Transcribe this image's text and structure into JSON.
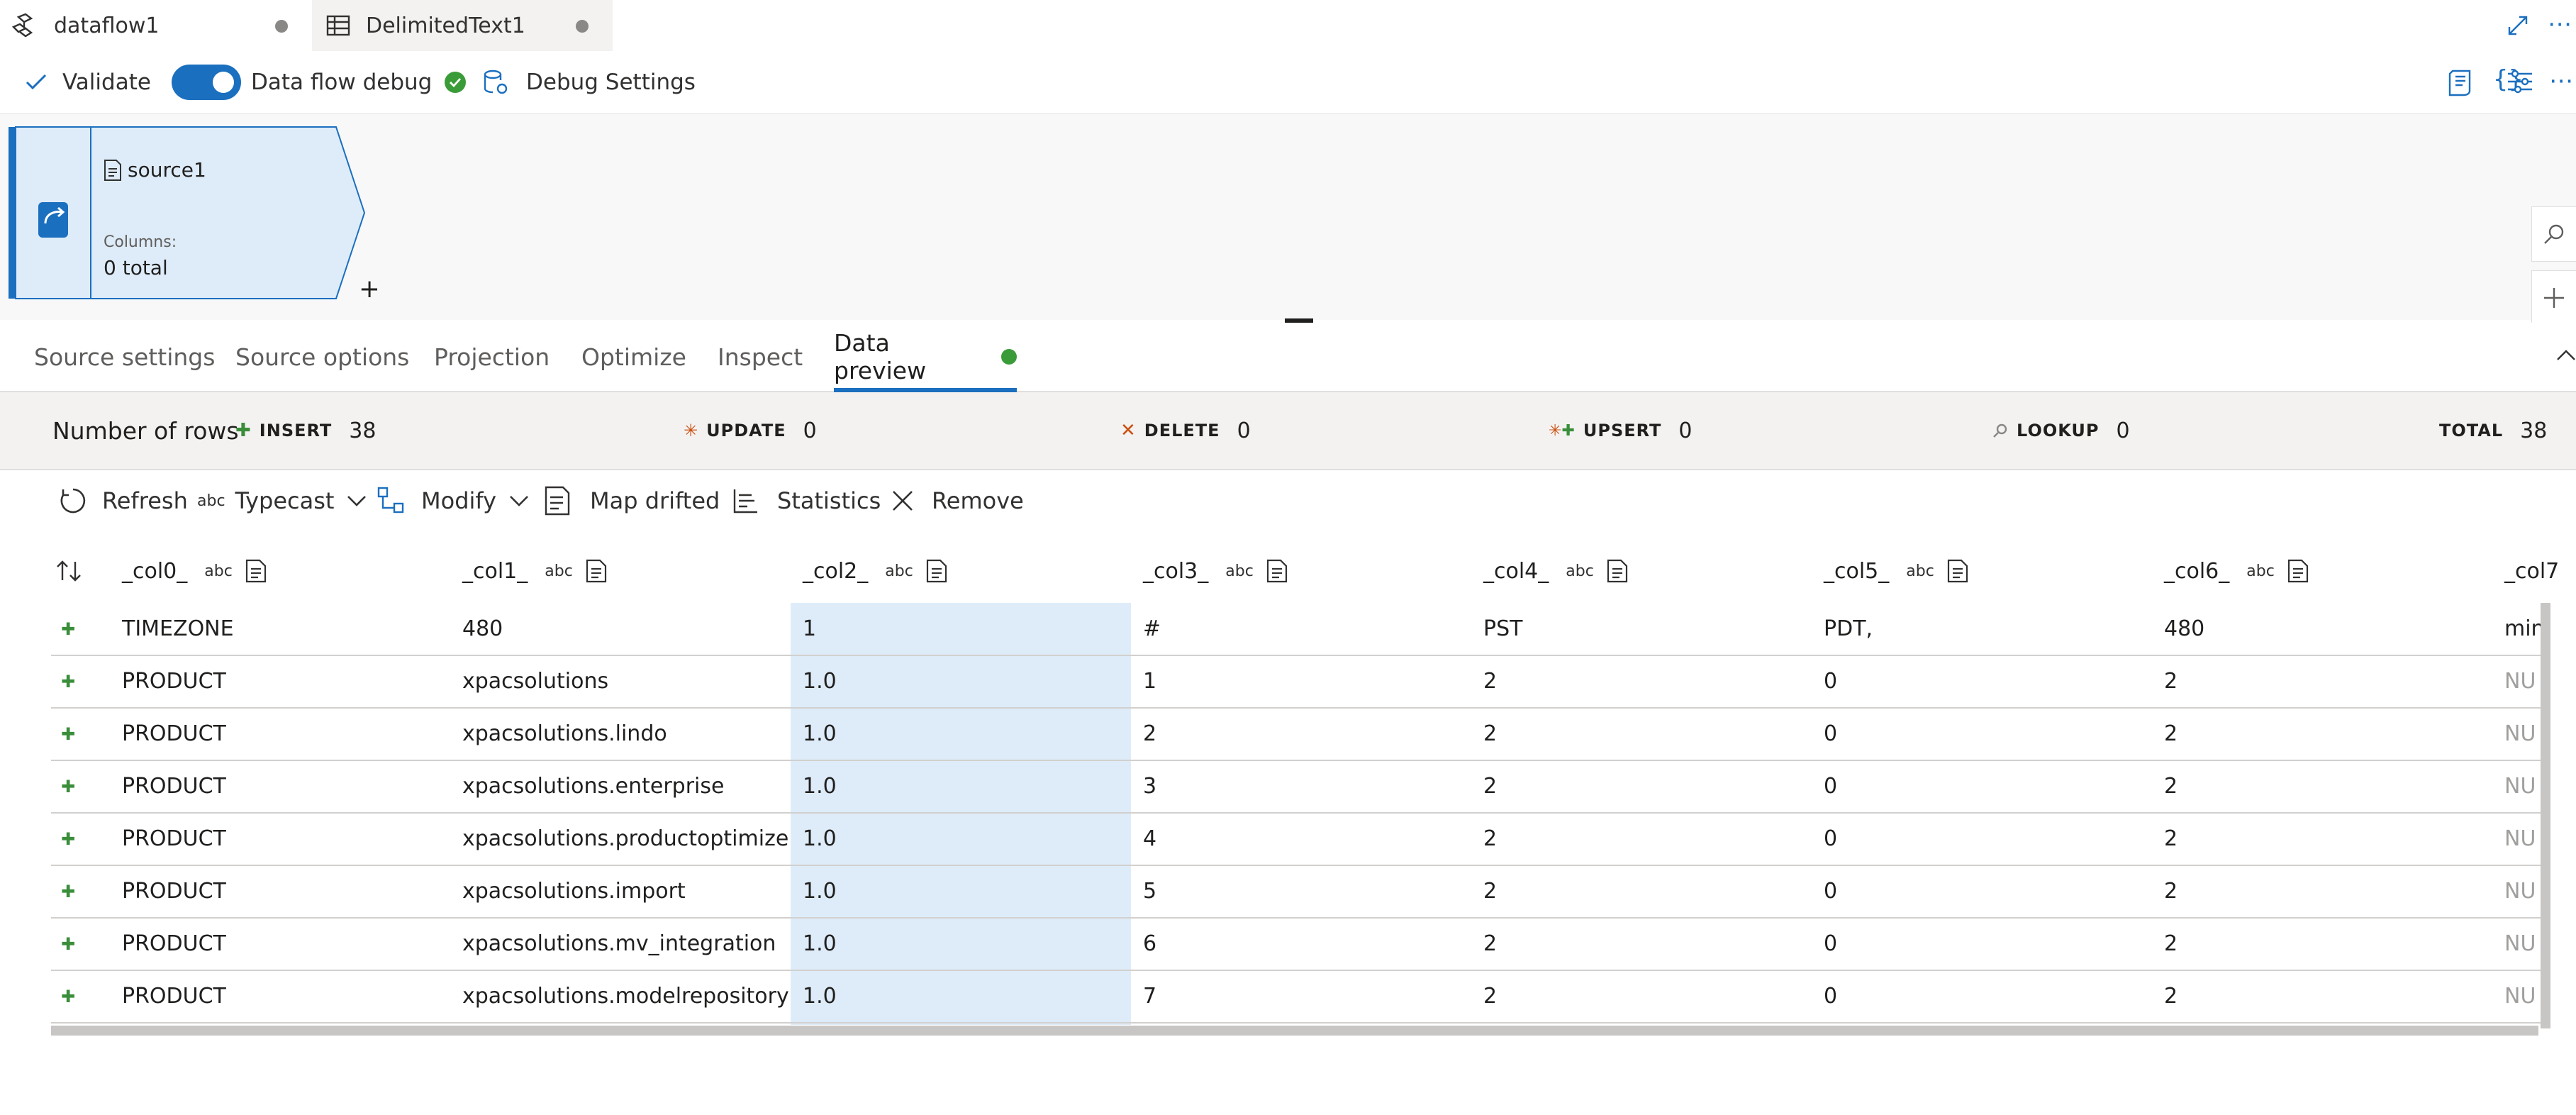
{
  "tabs": [
    {
      "label": "dataflow1",
      "icon": "dataflow-icon"
    },
    {
      "label": "DelimitedText1",
      "icon": "table-icon"
    }
  ],
  "commands": {
    "validate": "Validate",
    "debug": "Data flow debug",
    "debug_settings": "Debug Settings"
  },
  "node": {
    "name": "source1",
    "columns_label": "Columns:",
    "columns_value": "0 total"
  },
  "property_tabs": [
    "Source settings",
    "Source options",
    "Projection",
    "Optimize",
    "Inspect",
    "Data preview"
  ],
  "counts": {
    "title": "Number of rows",
    "insert_label": "INSERT",
    "insert": "38",
    "update_label": "UPDATE",
    "update": "0",
    "delete_label": "DELETE",
    "delete": "0",
    "upsert_label": "UPSERT",
    "upsert": "0",
    "lookup_label": "LOOKUP",
    "lookup": "0",
    "total_label": "TOTAL",
    "total": "38"
  },
  "toolbar": {
    "refresh": "Refresh",
    "typecast": "Typecast",
    "modify": "Modify",
    "map_drifted": "Map drifted",
    "statistics": "Statistics",
    "remove": "Remove",
    "abc": "abc"
  },
  "columns": [
    "_col0_",
    "_col1_",
    "_col2_",
    "_col3_",
    "_col4_",
    "_col5_",
    "_col6_",
    "_col7"
  ],
  "col_type": "abc",
  "rows": [
    [
      "TIMEZONE",
      "480",
      "1",
      "#",
      "PST",
      "PDT,",
      "480",
      "min"
    ],
    [
      "PRODUCT",
      "xpacsolutions",
      "1.0",
      "1",
      "2",
      "0",
      "2",
      "NU"
    ],
    [
      "PRODUCT",
      "xpacsolutions.lindo",
      "1.0",
      "2",
      "2",
      "0",
      "2",
      "NU"
    ],
    [
      "PRODUCT",
      "xpacsolutions.enterprise",
      "1.0",
      "3",
      "2",
      "0",
      "2",
      "NU"
    ],
    [
      "PRODUCT",
      "xpacsolutions.productoptimizer",
      "1.0",
      "4",
      "2",
      "0",
      "2",
      "NU"
    ],
    [
      "PRODUCT",
      "xpacsolutions.import",
      "1.0",
      "5",
      "2",
      "0",
      "2",
      "NU"
    ],
    [
      "PRODUCT",
      "xpacsolutions.mv_integration",
      "1.0",
      "6",
      "2",
      "0",
      "2",
      "NU"
    ],
    [
      "PRODUCT",
      "xpacsolutions.modelrepository",
      "1.0",
      "7",
      "2",
      "0",
      "2",
      "NU"
    ]
  ],
  "colors": {
    "accent": "#1b6fbf",
    "success": "#3a9c39",
    "highlight": "#deecf9"
  }
}
